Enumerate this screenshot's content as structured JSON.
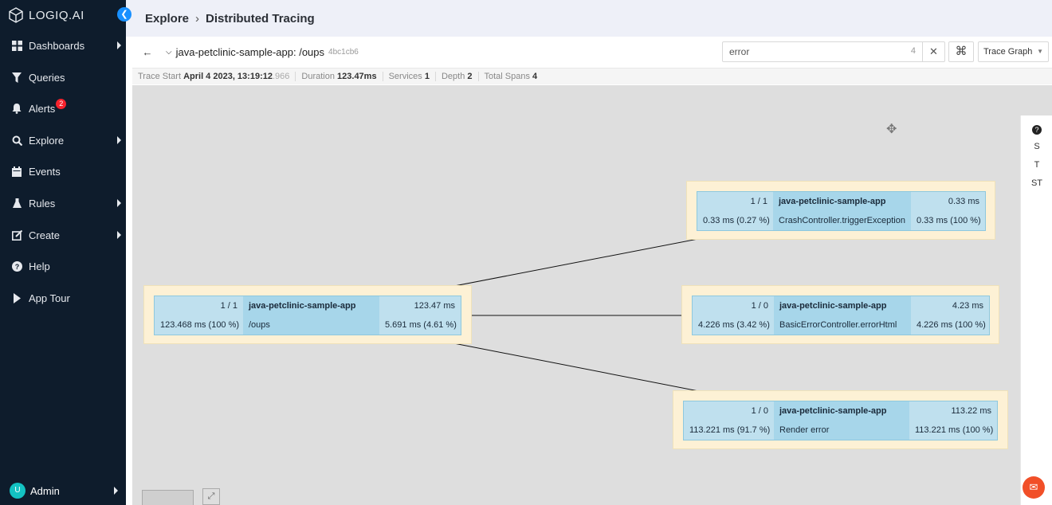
{
  "sidebar": {
    "logo": "LOGIQ.AI",
    "items": [
      {
        "label": "Dashboards",
        "icon": "grid-icon",
        "arrow": true
      },
      {
        "label": "Queries",
        "icon": "filter-icon",
        "arrow": false
      },
      {
        "label": "Alerts",
        "icon": "bell-icon",
        "arrow": false,
        "badge": "2"
      },
      {
        "label": "Explore",
        "icon": "search-icon",
        "arrow": true
      },
      {
        "label": "Events",
        "icon": "calendar-icon",
        "arrow": false
      },
      {
        "label": "Rules",
        "icon": "flask-icon",
        "arrow": true
      },
      {
        "label": "Create",
        "icon": "edit-icon",
        "arrow": true
      },
      {
        "label": "Help",
        "icon": "help-icon",
        "arrow": false
      },
      {
        "label": "App Tour",
        "icon": "play-icon",
        "arrow": false
      }
    ],
    "user": {
      "initial": "U",
      "name": "Admin"
    }
  },
  "header": {
    "crumb1": "Explore",
    "crumb2": "Distributed Tracing"
  },
  "trace": {
    "title": "java-petclinic-sample-app: /oups",
    "id": "4bc1cb6",
    "search_value": "error",
    "search_count": "4",
    "view_mode": "Trace Graph"
  },
  "summary": {
    "trace_start_label": "Trace Start",
    "trace_start_value": "April 4 2023, 13:19:12",
    "trace_start_ms": ".966",
    "duration_label": "Duration",
    "duration_value": "123.47ms",
    "services_label": "Services",
    "services_value": "1",
    "depth_label": "Depth",
    "depth_value": "2",
    "spans_label": "Total Spans",
    "spans_value": "4"
  },
  "tools": [
    "?",
    "S",
    "T",
    "ST"
  ],
  "nodes": [
    {
      "count": "1 / 1",
      "service": "java-petclinic-sample-app",
      "total": "123.47 ms",
      "self": "123.468 ms (100 %)",
      "operation": "/oups",
      "self_pct": "5.691 ms (4.61 %)"
    },
    {
      "count": "1 / 1",
      "service": "java-petclinic-sample-app",
      "total": "0.33 ms",
      "self": "0.33 ms (0.27 %)",
      "operation": "CrashController.triggerException",
      "self_pct": "0.33 ms (100 %)"
    },
    {
      "count": "1 / 0",
      "service": "java-petclinic-sample-app",
      "total": "4.23 ms",
      "self": "4.226 ms (3.42 %)",
      "operation": "BasicErrorController.errorHtml",
      "self_pct": "4.226 ms (100 %)"
    },
    {
      "count": "1 / 0",
      "service": "java-petclinic-sample-app",
      "total": "113.22 ms",
      "self": "113.221 ms (91.7 %)",
      "operation": "Render error",
      "self_pct": "113.221 ms (100 %)"
    }
  ],
  "colors": {
    "sidebar": "#0e1c2c",
    "accent": "#1890ff",
    "node_bg": "#fdf1d5",
    "cell": "#bfe0ee",
    "cell_dark": "#a7d6ea"
  }
}
